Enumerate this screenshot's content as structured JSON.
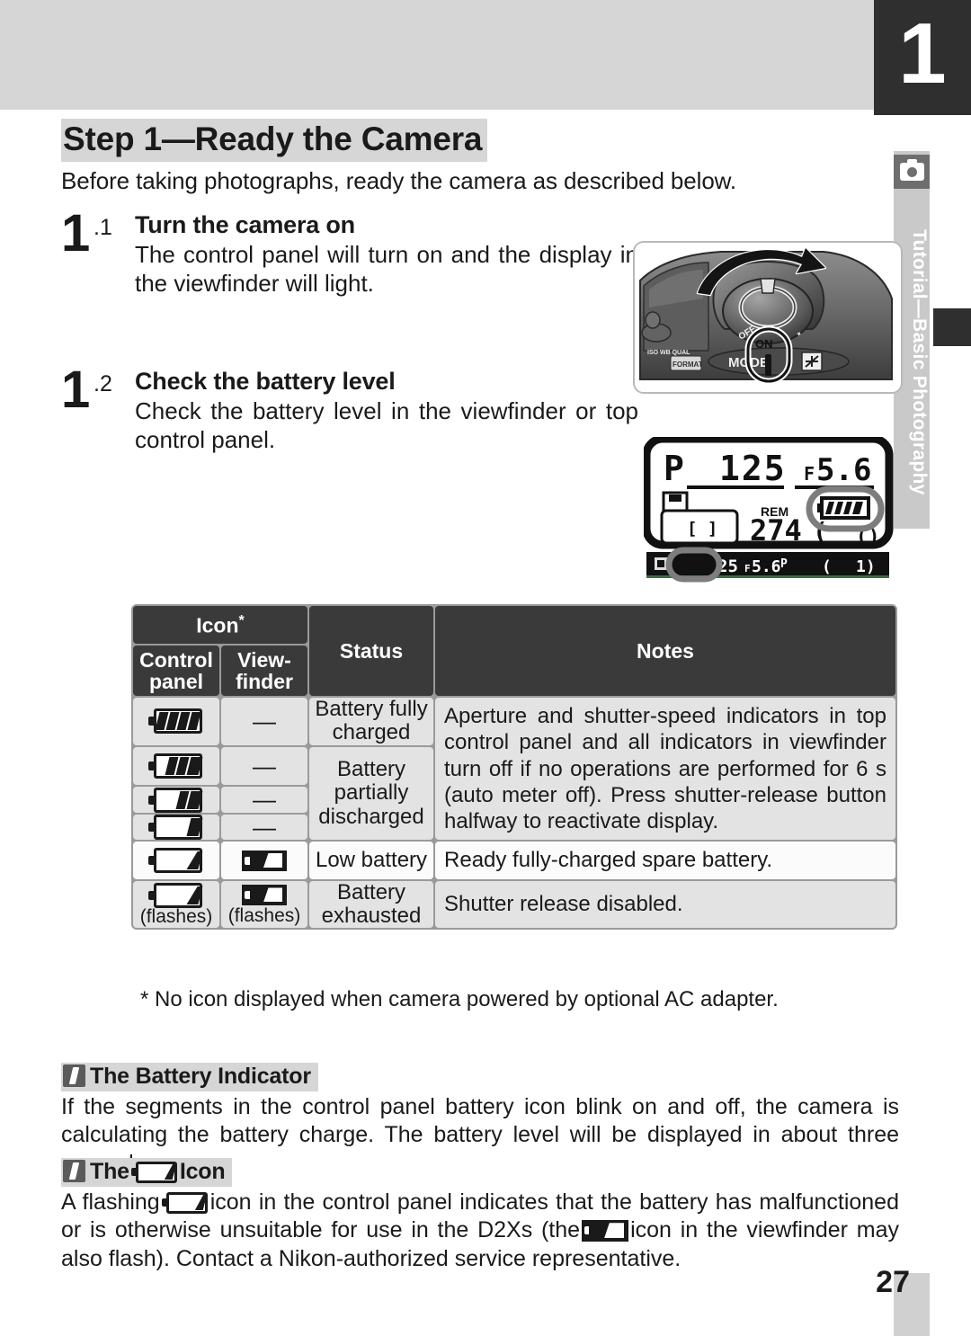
{
  "page": {
    "chapter_number": "1",
    "page_number": "27",
    "title": "Step 1—Ready the Camera",
    "intro": "Before taking photographs, ready the camera as described below."
  },
  "side_tab": {
    "label": "Tutorial—Basic Photography",
    "icon": "camera-icon"
  },
  "steps": [
    {
      "number": "1",
      "sub": ".1",
      "title": "Turn the camera on",
      "text": "The control panel will turn on and the display in the viewfinder will light.",
      "figure": "camera-power-switch-illustration"
    },
    {
      "number": "1",
      "sub": ".2",
      "title": "Check the battery level",
      "text": "Check the battery level in the viewfinder or top control panel.",
      "figure": "control-panel-lcd-illustration"
    }
  ],
  "control_panel_lcd": {
    "mode": "P",
    "shutter_speed": "125",
    "aperture": "F5.6",
    "rem_label": "REM",
    "frames_remaining": "274",
    "focus_brackets": "[ ]",
    "viewfinder_shutter_speed": "25",
    "viewfinder_aperture": "F5.6",
    "viewfinder_mode": "P",
    "viewfinder_frames": "[ 1 ]"
  },
  "table": {
    "headers": {
      "icon_group": "Icon",
      "icon_group_star": "*",
      "control_panel": "Control panel",
      "viewfinder": "View- finder",
      "status": "Status",
      "notes": "Notes"
    },
    "rows": [
      {
        "control_panel_icon": "battery-full-icon",
        "control_panel_segments": 4,
        "viewfinder_icon": "dash",
        "viewfinder_text": "—",
        "status": "Battery fully charged",
        "flashes": false
      },
      {
        "control_panel_icon": "battery-three-quarter-icon",
        "control_panel_segments": 3,
        "viewfinder_icon": "dash",
        "viewfinder_text": "—",
        "status": "",
        "flashes": false
      },
      {
        "control_panel_icon": "battery-half-icon",
        "control_panel_segments": 2,
        "viewfinder_icon": "dash",
        "viewfinder_text": "—",
        "status": "",
        "flashes": false
      },
      {
        "control_panel_icon": "battery-low-segments-icon",
        "control_panel_segments": 1,
        "viewfinder_icon": "dash",
        "viewfinder_text": "—",
        "status": "",
        "flashes": false
      },
      {
        "control_panel_icon": "battery-empty-wedge-icon",
        "control_panel_segments": 0,
        "viewfinder_icon": "battery-inverted-icon",
        "viewfinder_text": "",
        "status": "Low battery",
        "flashes": false
      },
      {
        "control_panel_icon": "battery-empty-wedge-icon",
        "control_panel_segments": 0,
        "viewfinder_icon": "battery-inverted-icon",
        "viewfinder_text": "",
        "status": "Battery exhausted",
        "flashes": true
      }
    ],
    "status_partial": "Battery partially discharged",
    "flashes_label": "(flashes)",
    "notes": {
      "group1": "Aperture and shutter-speed indicators in top control panel and all indicators in viewfinder turn off if no operations are performed for 6 s (auto meter off).  Press shutter-release button halfway to reactivate display.",
      "low_battery": "Ready fully-charged spare battery.",
      "exhausted": "Shutter release disabled."
    }
  },
  "footnote": "* No icon displayed when camera powered by optional AC adapter.",
  "tips": [
    {
      "heading_prefix": "The Battery Indicator",
      "icon": "pencil-note-icon",
      "body": "If the segments in the control panel battery icon blink on and off, the camera is calculating the battery charge.  The battery level will be displayed in about three seconds."
    },
    {
      "heading_the": "The",
      "heading_icon": "Icon",
      "icon": "pencil-note-icon",
      "body_part1": "A flashing",
      "body_part2": "icon in the control panel indicates that the battery has malfunctioned or is otherwise unsuitable for use in the D2Xs (the",
      "body_part3": "icon in the viewfinder may also flash).  Contact a Nikon-authorized service representative."
    }
  ],
  "colors": {
    "band_gray": "#d6d6d6",
    "tab_dark": "#2f2f2f",
    "table_header": "#3a3a3a",
    "cell_gray": "#e3e3e3",
    "cell_light": "#fbfbfb",
    "rule_gray": "#9a9a9a"
  }
}
